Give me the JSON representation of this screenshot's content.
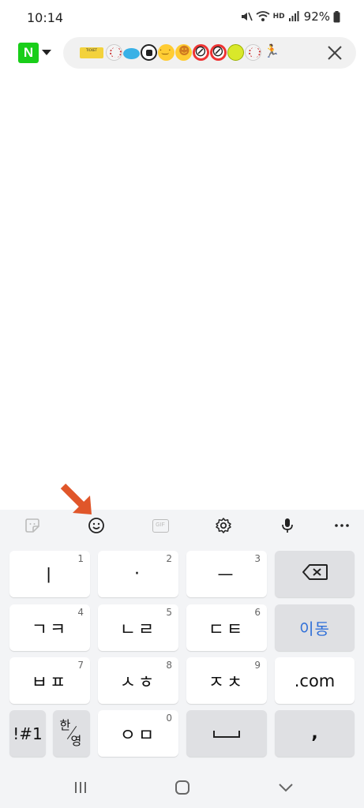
{
  "status_bar": {
    "time": "10:14",
    "battery": "92%",
    "hd_label": "HD",
    "icons": [
      "mute-icon",
      "wifi-icon",
      "hd-voice-icon",
      "signal-icon",
      "battery-icon"
    ]
  },
  "browser": {
    "logo_letter": "N",
    "search_query_emojis": [
      "ticket",
      "baseball",
      "flying-disc",
      "soccer-ball",
      "kissing-face",
      "person-in-lotus",
      "no-bicycles",
      "no-bicycles",
      "softball",
      "baseball",
      "person-running"
    ],
    "ticket_text": "TICKET"
  },
  "keyboard": {
    "toolbar_icons": [
      "sticker-icon",
      "emoji-icon",
      "gif-icon",
      "settings-gear-icon",
      "microphone-icon",
      "more-icon"
    ],
    "gif_label": "GIF",
    "rows": [
      [
        {
          "label": "ㅣ",
          "num": "1"
        },
        {
          "label": "·",
          "num": "2"
        },
        {
          "label": "ㅡ",
          "num": "3"
        },
        {
          "label": "",
          "num": ""
        }
      ],
      [
        {
          "label": "ㄱㅋ",
          "num": "4"
        },
        {
          "label": "ㄴㄹ",
          "num": "5"
        },
        {
          "label": "ㄷㅌ",
          "num": "6"
        },
        {
          "label": "이동",
          "num": ""
        }
      ],
      [
        {
          "label": "ㅂㅍ",
          "num": "7"
        },
        {
          "label": "ㅅㅎ",
          "num": "8"
        },
        {
          "label": "ㅈㅊ",
          "num": "9"
        },
        {
          "label": ".com",
          "num": ""
        }
      ]
    ],
    "bottom_row": {
      "symbols": "!#1",
      "han": "한",
      "young": "영",
      "om": "ㅇㅁ",
      "om_num": "0",
      "space": "",
      "comma": ","
    }
  },
  "system_nav": [
    "recent-apps-icon",
    "home-icon",
    "back-icon"
  ],
  "colors": {
    "naver_green": "#19ce19",
    "action_blue": "#2f6fd8",
    "annotation_orange": "#e0562a",
    "keyboard_bg": "#f3f4f6"
  }
}
